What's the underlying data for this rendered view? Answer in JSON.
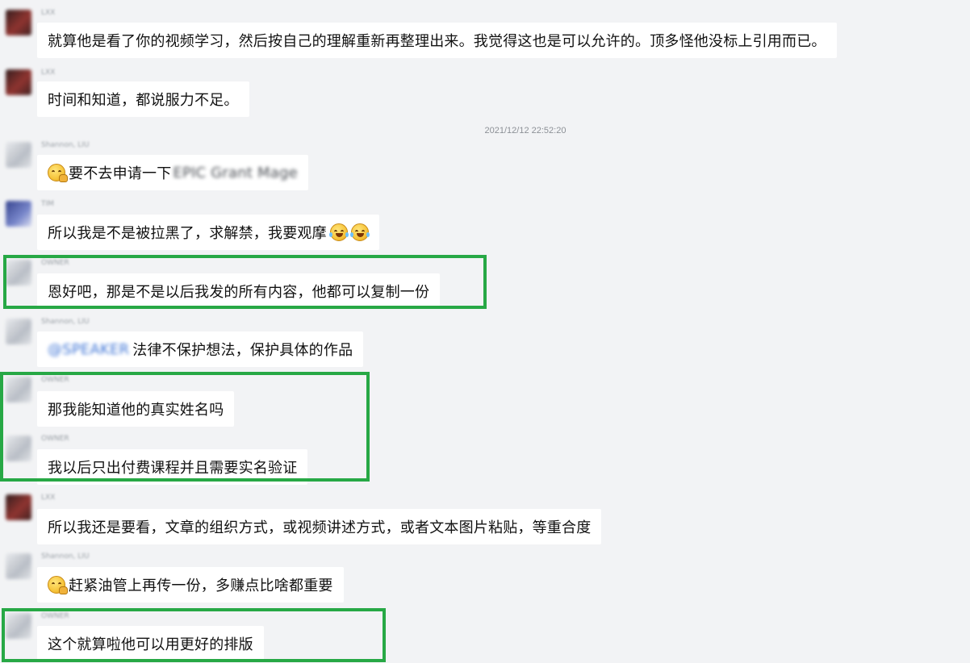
{
  "timestamp": "2021/12/12 22:52:20",
  "messages": [
    {
      "sender": "LXX",
      "text": "就算他是看了你的视频学习，然后按自己的理解重新再整理出来。我觉得这也是可以允许的。顶多怪他没标上引用而已。"
    },
    {
      "sender": "LXX",
      "text": "时间和知道，都说服力不足。"
    },
    {
      "sender": "Shannon, LIU",
      "text": "要不去申请一下",
      "blurred_suffix": "EPIC Grant Mage",
      "emoji": "smirk-emoji"
    },
    {
      "sender": "TIM",
      "text": "所以我是不是被拉黑了，求解禁，我要观摩",
      "emoji": "tears-of-joy-emoji"
    },
    {
      "sender": "OWNER",
      "text": "恩好吧，那是不是以后我发的所有内容，他都可以复制一份"
    },
    {
      "sender": "Shannon, LIU",
      "text": "法律不保护想法，保护具体的作品",
      "mention": "@SPEAKER"
    },
    {
      "sender": "OWNER",
      "text": "那我能知道他的真实姓名吗"
    },
    {
      "sender": "OWNER",
      "text": "我以后只出付费课程并且需要实名验证"
    },
    {
      "sender": "LXX",
      "text": "所以我还是要看，文章的组织方式，或视频讲述方式，或者文本图片粘贴，等重合度"
    },
    {
      "sender": "Shannon, LIU",
      "text": "赶紧油管上再传一份，多赚点比啥都重要",
      "emoji": "smirk-emoji"
    },
    {
      "sender": "OWNER",
      "text": "这个就算啦他可以用更好的排版"
    }
  ],
  "colors": {
    "background": "#f2f3f5",
    "bubble": "#ffffff",
    "highlight": "#27a845",
    "timestamp": "#8c9096"
  }
}
